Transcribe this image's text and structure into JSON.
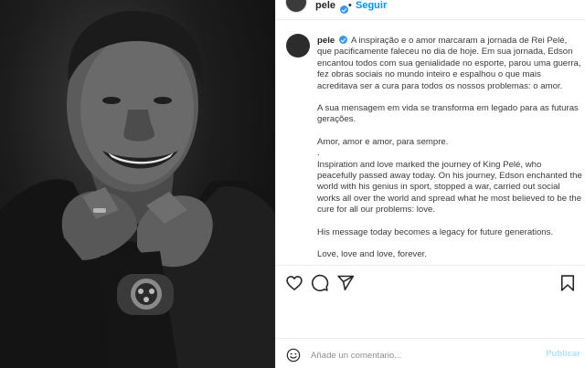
{
  "post": {
    "username": "pele",
    "follow_label": "Seguir",
    "separator": "•"
  },
  "caption": {
    "username": "pele",
    "paragraphs": [
      "A inspiração e o amor marcaram a jornada de Rei Pelé, que pacificamente faleceu no dia de hoje. Em sua jornada, Edson encantou todos com sua genialidade no esporte, parou uma guerra, fez obras sociais no mundo inteiro e espalhou o que mais acreditava ser a cura para todos os nossos problemas: o amor.",
      "A sua mensagem em vida se transforma em legado para as futuras gerações.",
      "Amor, amor e amor, para sempre.",
      ".",
      "Inspiration and love marked the journey of King Pelé, who peacefully passed away today. On his journey, Edson enchanted the world with his genius in sport, stopped a war, carried out social works all over the world and spread what he most believed to be the cure for all our problems: love.",
      "His message today becomes a legacy for future generations.",
      "Love, love and love, forever."
    ]
  },
  "actions": {
    "icons": [
      "heart-icon",
      "comment-icon",
      "share-icon",
      "bookmark-icon"
    ]
  },
  "comment_box": {
    "placeholder": "Añade un comentario...",
    "publish_label": "Publicar"
  },
  "colors": {
    "link_blue": "#0095f6",
    "verified_blue": "#3897f0",
    "publish_disabled": "#b2dffc",
    "text": "#262626"
  }
}
